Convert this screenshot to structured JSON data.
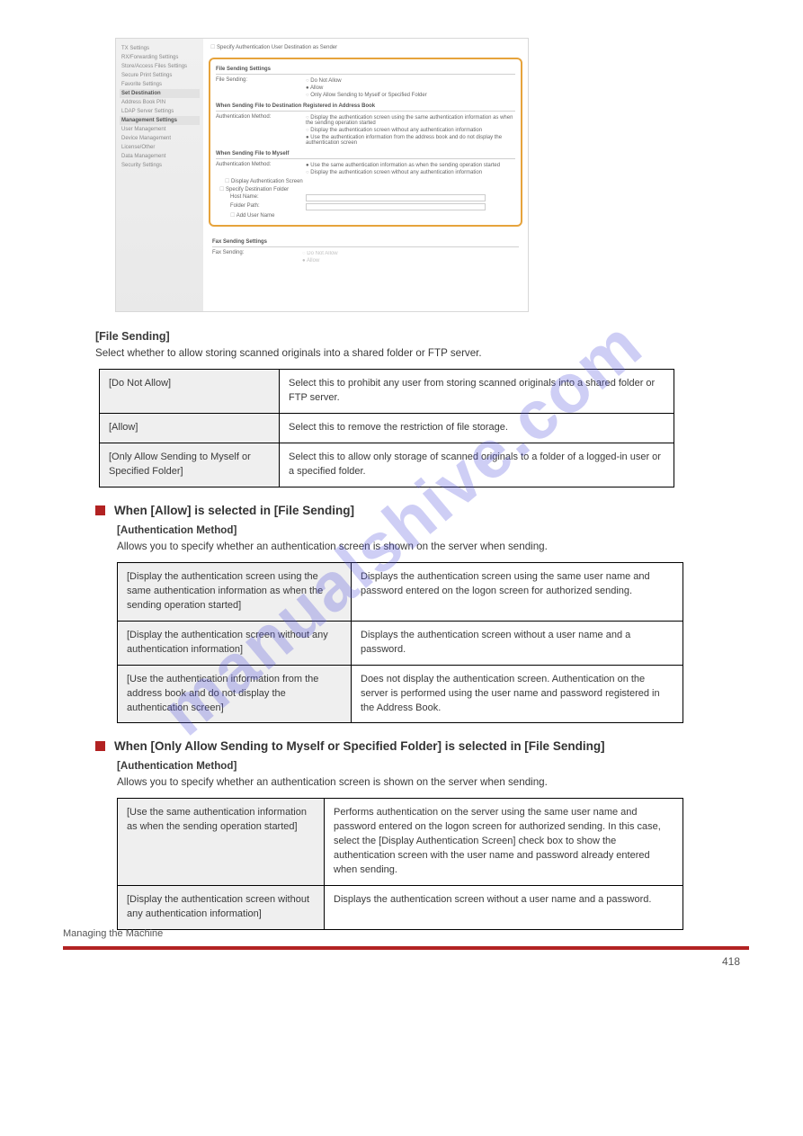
{
  "footer": {
    "chapter": "Managing the Machine",
    "page": "418"
  },
  "watermark": "manualshive.com",
  "ui": {
    "sidebar": {
      "groups": [
        {
          "header": "TX Settings",
          "items": []
        },
        {
          "header": "",
          "items": [
            "RX/Forwarding Settings",
            "Store/Access Files Settings",
            "Secure Print Settings",
            "Favorite Settings"
          ]
        },
        {
          "header": "Set Destination",
          "items": [
            "Address Book PIN",
            "LDAP Server Settings"
          ]
        },
        {
          "header": "Management Settings",
          "items": [
            "User Management",
            "Device Management",
            "License/Other",
            "Data Management",
            "Security Settings"
          ]
        }
      ]
    },
    "top_checkbox": "Specify Authentication User Destination as Sender",
    "file_sending": {
      "title": "File Sending Settings",
      "row_label": "File Sending:",
      "opts": [
        "Do Not Allow",
        "Allow",
        "Only Allow Sending to Myself or Specified Folder"
      ],
      "selected": 1
    },
    "sec_ab": {
      "title": "When Sending File to Destination Registered in Address Book",
      "row_label": "Authentication Method:",
      "opts": [
        "Display the authentication screen using the same authentication information as when the sending operation started",
        "Display the authentication screen without any authentication information",
        "Use the authentication information from the address book and do not display the authentication screen"
      ],
      "selected": 2
    },
    "sec_myself": {
      "title": "When Sending File to Myself",
      "row_label": "Authentication Method:",
      "opts": [
        "Use the same authentication information as when the sending operation started",
        "Display the authentication screen without any authentication information"
      ],
      "selected": 0,
      "chk_display": "Display Authentication Screen",
      "chk_spec": "Specify Destination Folder",
      "host": "Host Name:",
      "folder": "Folder Path:",
      "adduser": "Add User Name"
    },
    "fax": {
      "title": "Fax Sending Settings",
      "row_label": "Fax Sending:",
      "opts": [
        "Do Not Allow",
        "Allow"
      ]
    }
  },
  "intro": {
    "label": "[File Sending]",
    "text": "Select whether to allow storing scanned originals into a shared folder or FTP server."
  },
  "table1": {
    "rows": [
      {
        "h": "[Do Not Allow]",
        "d": "Select this to prohibit any user from storing scanned originals into a shared folder or FTP server."
      },
      {
        "h": "[Allow]",
        "d": "Select this to remove the restriction of file storage."
      },
      {
        "h": "[Only Allow Sending to Myself or Specified Folder]",
        "d": "Select this to allow only storage of scanned originals to a folder of a logged-in user or a specified folder."
      }
    ]
  },
  "sub1": {
    "title": "When [Allow] is selected in [File Sending]",
    "lead_label": "[Authentication Method]",
    "lead_text": "Allows you to specify whether an authentication screen is shown on the server when sending.",
    "rows": [
      {
        "h": "[Display the authentication screen using the same authentication information as when the sending operation started]",
        "d": "Displays the authentication screen using the same user name and password entered on the logon screen for authorized sending."
      },
      {
        "h": "[Display the authentication screen without any authentication information]",
        "d": "Displays the authentication screen without a user name and a password."
      },
      {
        "h": "[Use the authentication information from the address book and do not display the authentication screen]",
        "d": "Does not display the authentication screen. Authentication on the server is performed using the user name and password registered in the Address Book."
      }
    ]
  },
  "sub2": {
    "title": "When [Only Allow Sending to Myself or Specified Folder] is selected in [File Sending]",
    "lead_label": "[Authentication Method]",
    "lead_text": "Allows you to specify whether an authentication screen is shown on the server when sending.",
    "rows": [
      {
        "h": "[Use the same authentication information as when the sending operation started]",
        "d": "Performs authentication on the server using the same user name and password entered on the logon screen for authorized sending. In this case, select the [Display Authentication Screen] check box to show the authentication screen with the user name and password already entered when sending."
      },
      {
        "h": "[Display the authentication screen without any authentication information]",
        "d": "Displays the authentication screen without a user name and a password."
      }
    ]
  }
}
